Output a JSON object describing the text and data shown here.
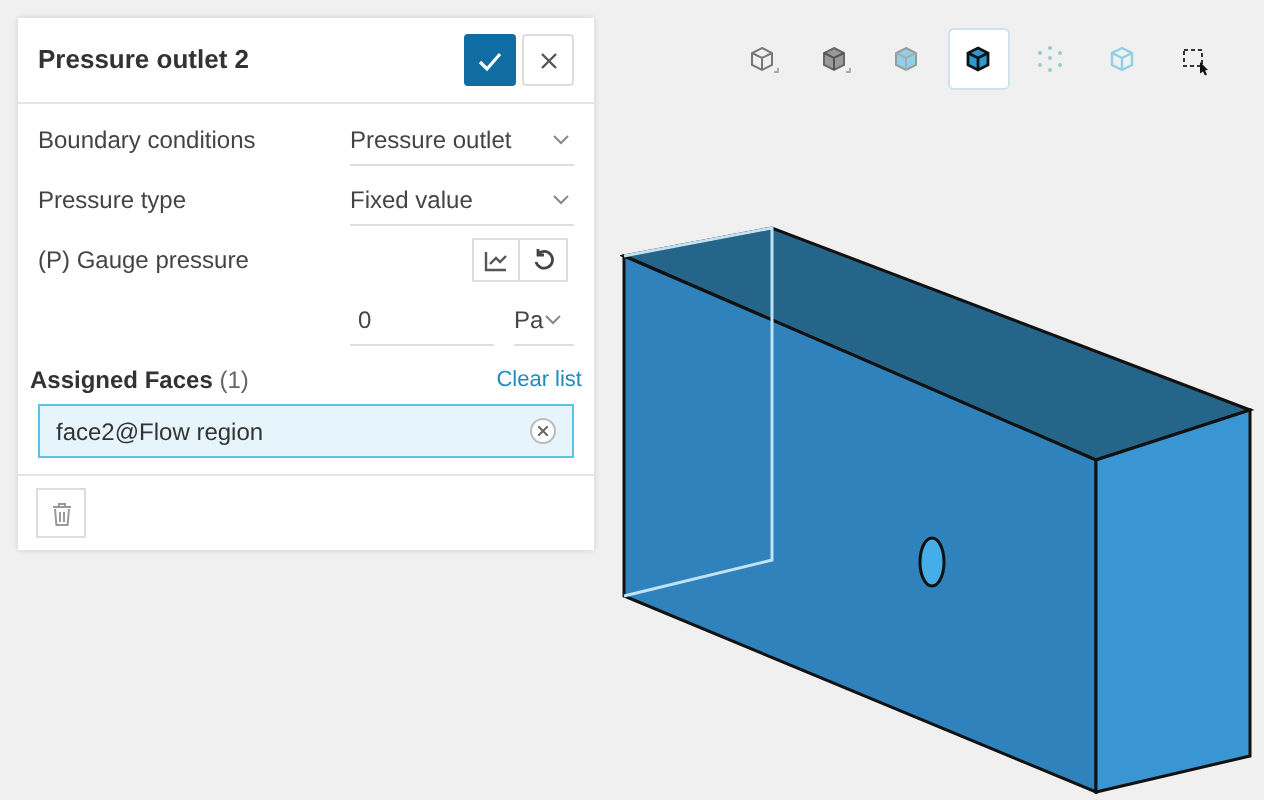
{
  "panel": {
    "title": "Pressure outlet 2",
    "fields": [
      {
        "kind": "select",
        "label": "Boundary conditions",
        "value": "Pressure outlet"
      },
      {
        "kind": "select",
        "label": "Pressure type",
        "value": "Fixed value"
      },
      {
        "kind": "tools",
        "label": "(P) Gauge pressure"
      },
      {
        "kind": "number",
        "value": "0",
        "unit": "Pa"
      }
    ],
    "assigned": {
      "label": "Assigned Faces",
      "count": "(1)",
      "clear": "Clear list",
      "items": [
        {
          "label": "face2@Flow region",
          "selected": true
        }
      ]
    }
  },
  "toolbar": [
    {
      "selected": false
    },
    {
      "selected": false
    },
    {
      "selected": false
    },
    {
      "selected": true
    },
    {
      "selected": false
    },
    {
      "selected": false
    },
    {
      "selected": false
    }
  ]
}
